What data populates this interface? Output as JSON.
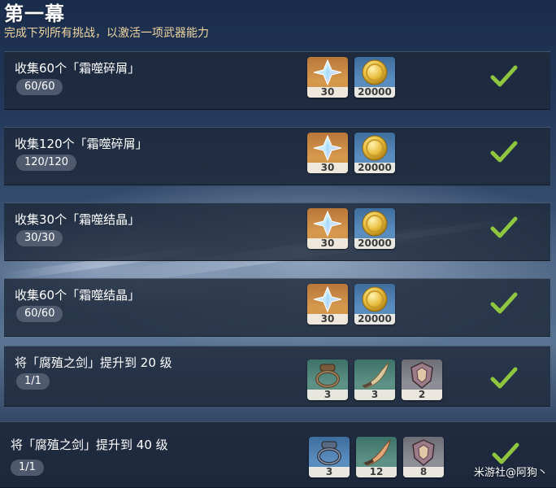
{
  "header": {
    "title": "第一幕",
    "subtitle": "完成下列所有挑战，以激活一项武器能力"
  },
  "tasks": [
    {
      "text": "收集60个「霜噬碎屑」",
      "progress": "60/60",
      "completed": true,
      "rewards": [
        {
          "icon": "primogem-icon",
          "count": "30"
        },
        {
          "icon": "mora-coin-icon",
          "count": "20000"
        }
      ]
    },
    {
      "text": "收集120个「霜噬碎屑」",
      "progress": "120/120",
      "completed": true,
      "rewards": [
        {
          "icon": "primogem-icon",
          "count": "30"
        },
        {
          "icon": "mora-coin-icon",
          "count": "20000"
        }
      ]
    },
    {
      "text": "收集30个「霜噬结晶」",
      "progress": "30/30",
      "completed": true,
      "rewards": [
        {
          "icon": "primogem-icon",
          "count": "30"
        },
        {
          "icon": "mora-coin-icon",
          "count": "20000"
        }
      ]
    },
    {
      "text": "收集60个「霜噬结晶」",
      "progress": "60/60",
      "completed": true,
      "rewards": [
        {
          "icon": "primogem-icon",
          "count": "30"
        },
        {
          "icon": "mora-coin-icon",
          "count": "20000"
        }
      ]
    },
    {
      "text": "将「腐殖之剑」提升到 20 级",
      "progress": "1/1",
      "completed": true,
      "rewards": [
        {
          "icon": "chain-material-icon",
          "count": "3"
        },
        {
          "icon": "horn-material-icon",
          "count": "3"
        },
        {
          "icon": "crest-material-icon",
          "count": "2"
        }
      ]
    },
    {
      "text": "将「腐殖之剑」提升到 40 级",
      "progress": "1/1",
      "completed": true,
      "rewards": [
        {
          "icon": "chain-material-icon",
          "count": "3"
        },
        {
          "icon": "horn-material-icon",
          "count": "12"
        },
        {
          "icon": "crest-material-icon",
          "count": "8"
        }
      ]
    }
  ],
  "colors": {
    "accent_title": "#ffffff",
    "subtitle": "#f1d6a0",
    "check": "#8ec63f",
    "row_bg": "#1e283a"
  },
  "watermark": "米游社@阿狗丶"
}
